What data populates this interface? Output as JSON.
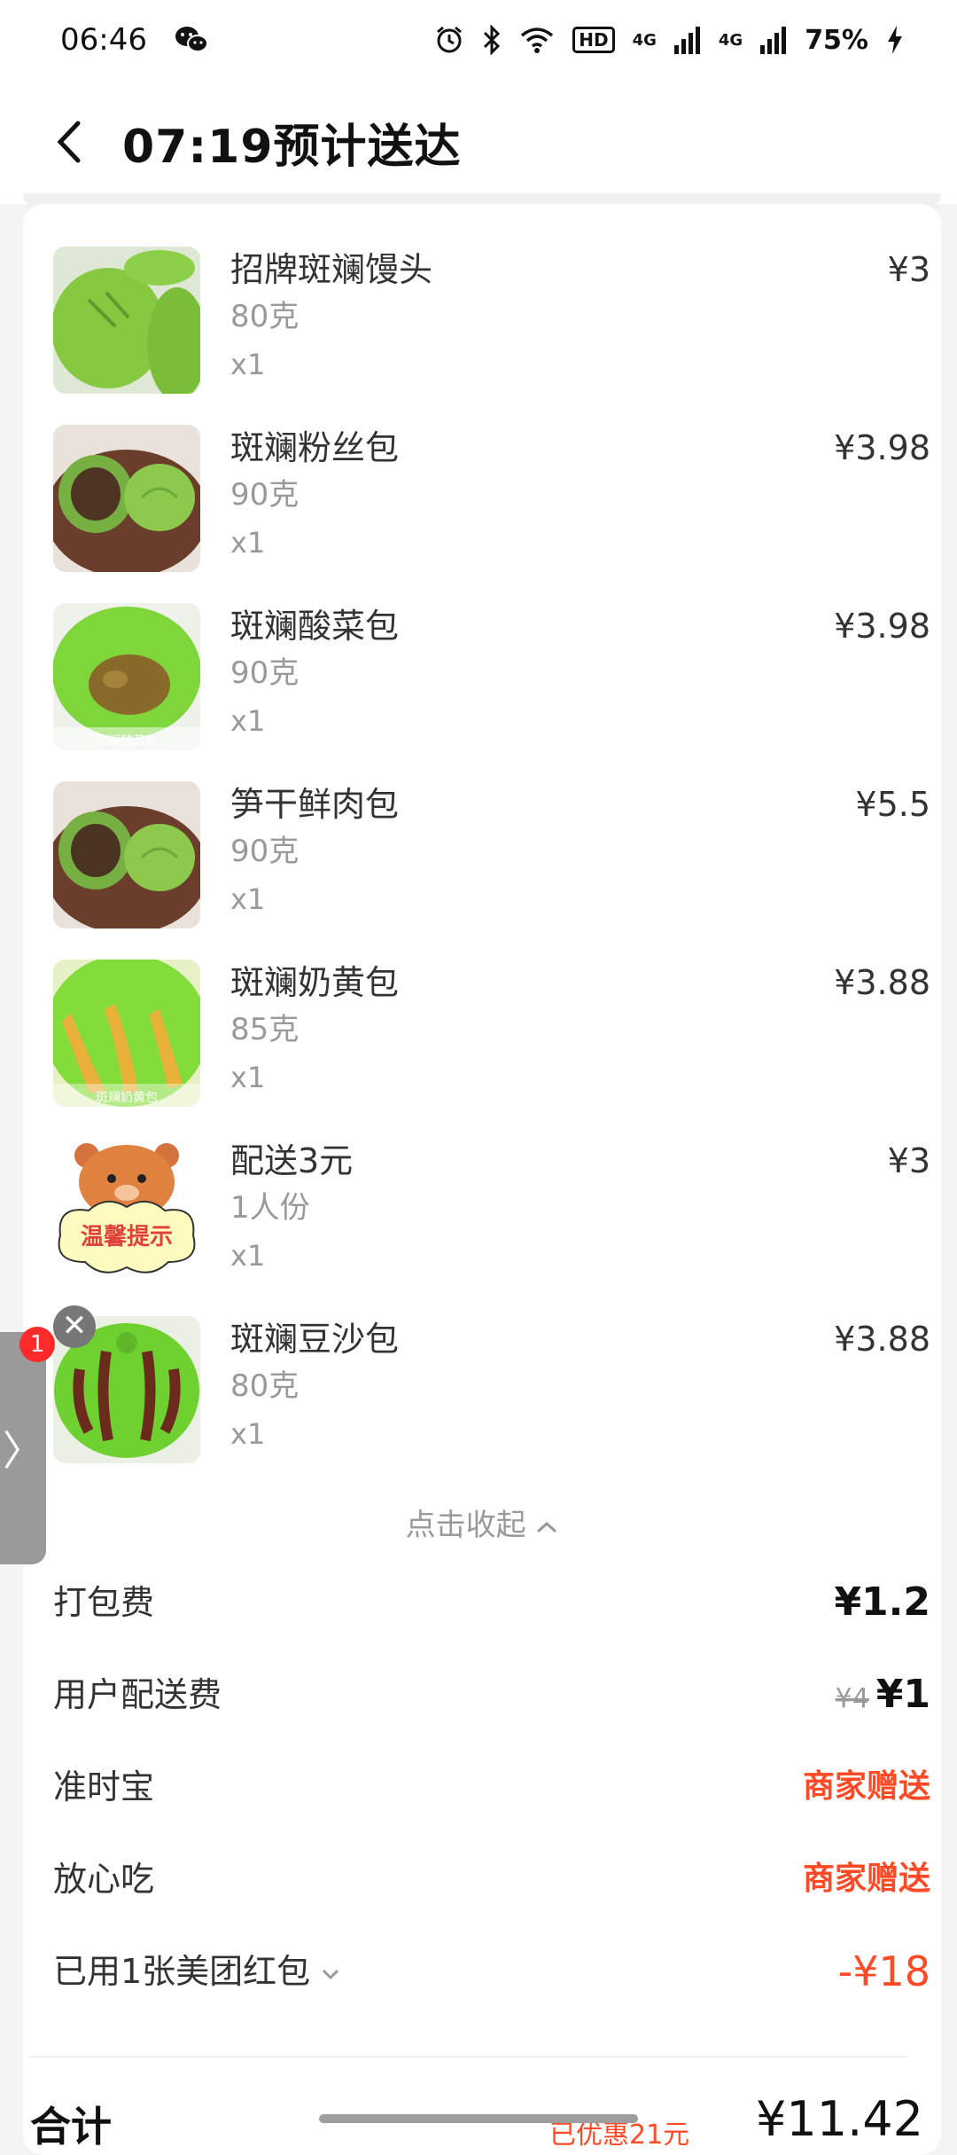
{
  "status_bar": {
    "time": "06:46",
    "battery": "75%",
    "hd_label": "HD",
    "net_label_1": "4G",
    "net_label_2": "4G",
    "icons": [
      "wechat-icon",
      "alarm-icon",
      "bluetooth-icon",
      "wifi-icon",
      "signal-icon",
      "bolt-icon"
    ]
  },
  "header": {
    "title": "07:19预计送达"
  },
  "items": [
    {
      "name": "招牌斑斓馒头",
      "spec": "80克",
      "qty": "x1",
      "price": "¥3"
    },
    {
      "name": "斑斓粉丝包",
      "spec": "90克",
      "qty": "x1",
      "price": "¥3.98"
    },
    {
      "name": "斑斓酸菜包",
      "spec": "90克",
      "qty": "x1",
      "price": "¥3.98"
    },
    {
      "name": "笋干鲜肉包",
      "spec": "90克",
      "qty": "x1",
      "price": "¥5.5"
    },
    {
      "name": "斑斓奶黄包",
      "spec": "85克",
      "qty": "x1",
      "price": "¥3.88"
    },
    {
      "name": "配送3元",
      "spec": "1人份",
      "qty": "x1",
      "price": "¥3"
    },
    {
      "name": "斑斓豆沙包",
      "spec": "80克",
      "qty": "x1",
      "price": "¥3.88"
    }
  ],
  "thumb_captions": {
    "item2": "斑斓酸菜包",
    "item4": "斑斓奶黄包",
    "item5": "温馨提示"
  },
  "collapse_label": "点击收起",
  "fees": {
    "packing_label": "打包费",
    "packing_value": "¥1.2",
    "delivery_label": "用户配送费",
    "delivery_original": "¥4",
    "delivery_value": "¥1",
    "ontime_label": "准时宝",
    "ontime_value": "商家赠送",
    "safe_label": "放心吃",
    "safe_value": "商家赠送",
    "redpacket_label": "已用1张美团红包",
    "redpacket_value": "-¥18"
  },
  "total": {
    "label": "合计",
    "saved": "已优惠21元",
    "value": "¥11.42"
  },
  "float_widget": {
    "badge": "1",
    "close": "✕",
    "arrow": "〉"
  },
  "colors": {
    "accent_red": "#ff4a26",
    "pandan_green": "#79c63a"
  }
}
